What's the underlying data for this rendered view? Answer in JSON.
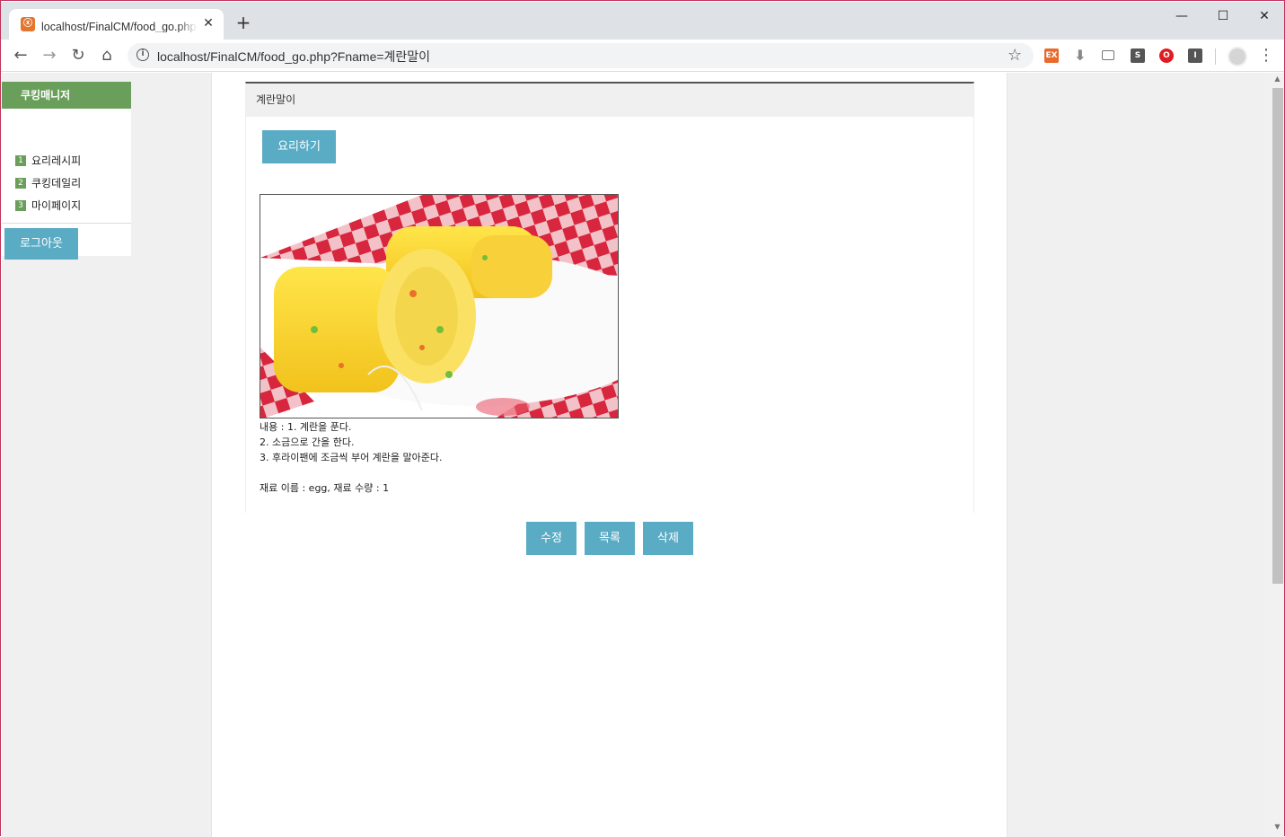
{
  "browser": {
    "tab_title": "localhost/FinalCM/food_go.php?Fname=계란말이",
    "tab_close": "✕",
    "new_tab": "+",
    "url": "localhost/FinalCM/food_go.php?Fname=계란말이",
    "window_controls": {
      "minimize": "—",
      "maximize": "☐",
      "close": "✕"
    },
    "extensions": [
      {
        "name": "extension-ex-icon",
        "label": "EX"
      },
      {
        "name": "download-arrow-icon",
        "label": "⬇"
      },
      {
        "name": "card-icon",
        "label": ""
      },
      {
        "name": "s-icon",
        "label": "S"
      },
      {
        "name": "opera-icon",
        "label": "O"
      },
      {
        "name": "i-icon",
        "label": "I"
      }
    ]
  },
  "sidebar": {
    "header": "쿠킹매니저",
    "items": [
      {
        "num": "1",
        "label": "요리레시피"
      },
      {
        "num": "2",
        "label": "쿠킹데일리"
      },
      {
        "num": "3",
        "label": "마이페이지"
      }
    ],
    "logout_label": "로그아웃"
  },
  "recipe": {
    "title": "계란말이",
    "cook_button": "요리하기",
    "content_lines": [
      "내용 : 1. 계란을 푼다.",
      "2. 소금으로 간을 한다.",
      "3. 후라이팬에 조금씩 부어 계란을 말아준다."
    ],
    "ingredients": "재료 이름 : egg, 재료 수량 : 1"
  },
  "actions": {
    "edit": "수정",
    "list": "목록",
    "delete": "삭제"
  },
  "colors": {
    "accent_button": "#5aabc4",
    "sidebar_green": "#6a9f5b",
    "window_border": "#c0315a"
  }
}
